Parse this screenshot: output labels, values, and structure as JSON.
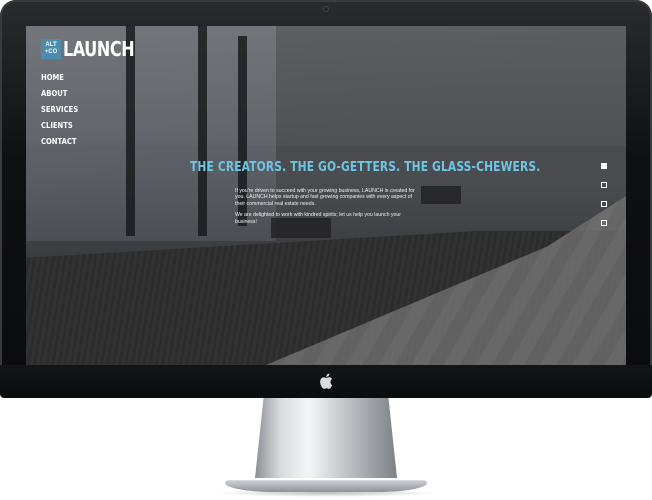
{
  "site": {
    "logo_badge_top": "ALT",
    "logo_badge_bottom": "+CO",
    "logo_word": "LAUNCH",
    "accent_color": "#6ec6e5",
    "badge_color": "#4b8bb0"
  },
  "nav": {
    "items": [
      {
        "label": "HOME"
      },
      {
        "label": "ABOUT"
      },
      {
        "label": "SERVICES"
      },
      {
        "label": "CLIENTS"
      },
      {
        "label": "CONTACT"
      }
    ]
  },
  "hero": {
    "headline": "THE CREATORS. THE GO-GETTERS. THE GLASS-CHEWERS.",
    "paragraph_1": "If you're driven to succeed with your growing business, LAUNCH is created for you. LAUNCH helps startup and fast growing companies with every aspect of their commercial real estate needs.",
    "paragraph_2": "We are delighted to work with kindred spirits; let us help you launch your business!"
  },
  "slider": {
    "count": 4,
    "active_index": 0
  },
  "device": {
    "logo_icon": "apple-logo-icon"
  }
}
